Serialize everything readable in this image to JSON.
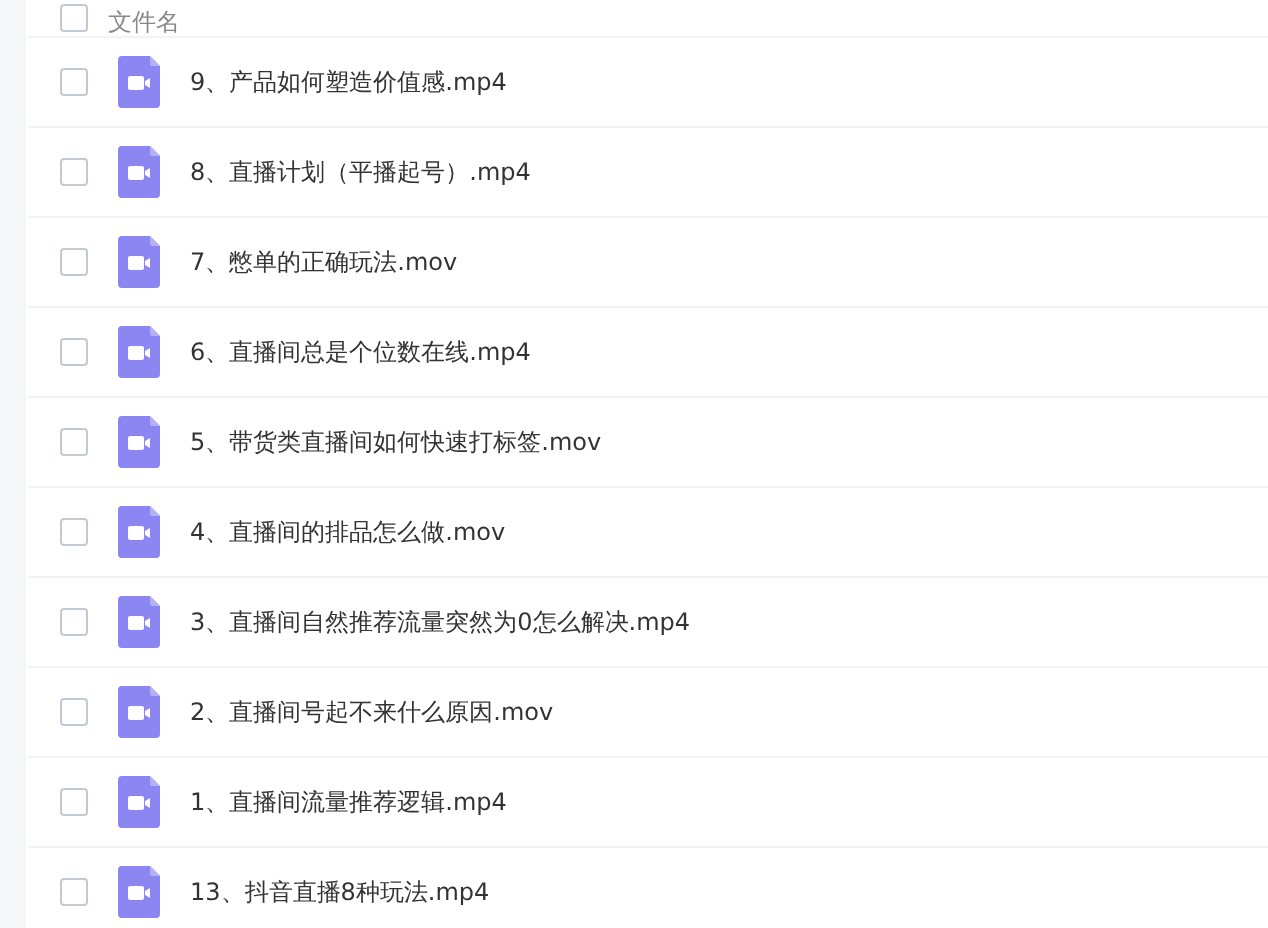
{
  "header": {
    "label": "文件名",
    "checked": false
  },
  "files": [
    {
      "name": "9、产品如何塑造价值感.mp4",
      "checked": false
    },
    {
      "name": "8、直播计划（平播起号）.mp4",
      "checked": false
    },
    {
      "name": "7、憋单的正确玩法.mov",
      "checked": false
    },
    {
      "name": "6、直播间总是个位数在线.mp4",
      "checked": false
    },
    {
      "name": "5、带货类直播间如何快速打标签.mov",
      "checked": false
    },
    {
      "name": "4、直播间的排品怎么做.mov",
      "checked": false
    },
    {
      "name": "3、直播间自然推荐流量突然为0怎么解决.mp4",
      "checked": false
    },
    {
      "name": "2、直播间号起不来什么原因.mov",
      "checked": false
    },
    {
      "name": "1、直播间流量推荐逻辑.mp4",
      "checked": false
    },
    {
      "name": "13、抖音直播8种玩法.mp4",
      "checked": false
    }
  ]
}
